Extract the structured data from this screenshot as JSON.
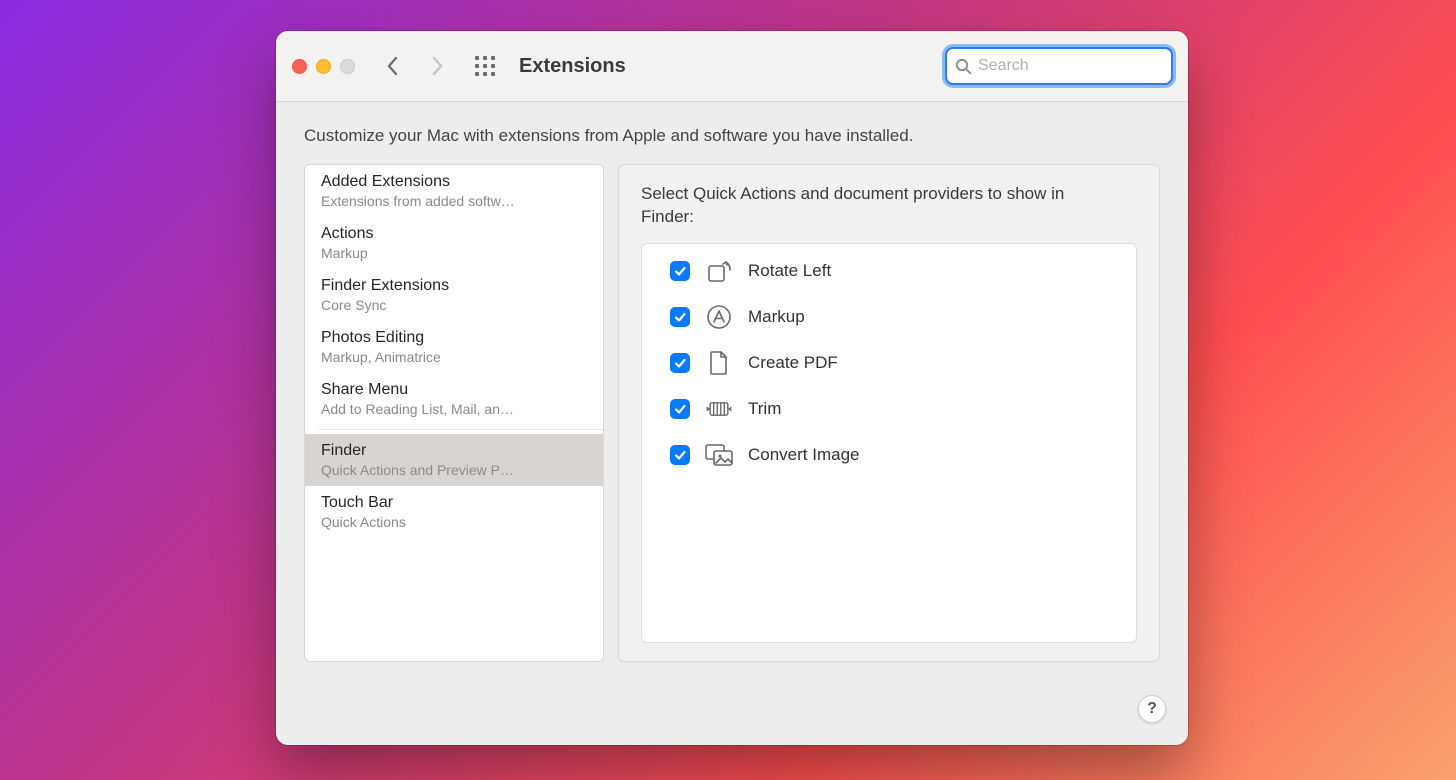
{
  "window": {
    "title": "Extensions",
    "search_placeholder": "Search"
  },
  "subtitle": "Customize your Mac with extensions from Apple and software you have installed.",
  "sidebar": {
    "items": [
      {
        "title": "Added Extensions",
        "detail": "Extensions from added softw…"
      },
      {
        "title": "Actions",
        "detail": "Markup"
      },
      {
        "title": "Finder Extensions",
        "detail": "Core Sync"
      },
      {
        "title": "Photos Editing",
        "detail": "Markup, Animatrice"
      },
      {
        "title": "Share Menu",
        "detail": "Add to Reading List, Mail, an…"
      },
      {
        "title": "Finder",
        "detail": "Quick Actions and Preview P…",
        "selected": true
      },
      {
        "title": "Touch Bar",
        "detail": "Quick Actions"
      }
    ],
    "separator_before_index": 5
  },
  "detail": {
    "heading": "Select Quick Actions and document providers to show in Finder:",
    "items": [
      {
        "label": "Rotate Left",
        "checked": true,
        "icon": "rotate-left-icon"
      },
      {
        "label": "Markup",
        "checked": true,
        "icon": "markup-icon"
      },
      {
        "label": "Create PDF",
        "checked": true,
        "icon": "document-icon"
      },
      {
        "label": "Trim",
        "checked": true,
        "icon": "trim-icon"
      },
      {
        "label": "Convert Image",
        "checked": true,
        "icon": "convert-image-icon"
      }
    ]
  },
  "help_label": "?"
}
